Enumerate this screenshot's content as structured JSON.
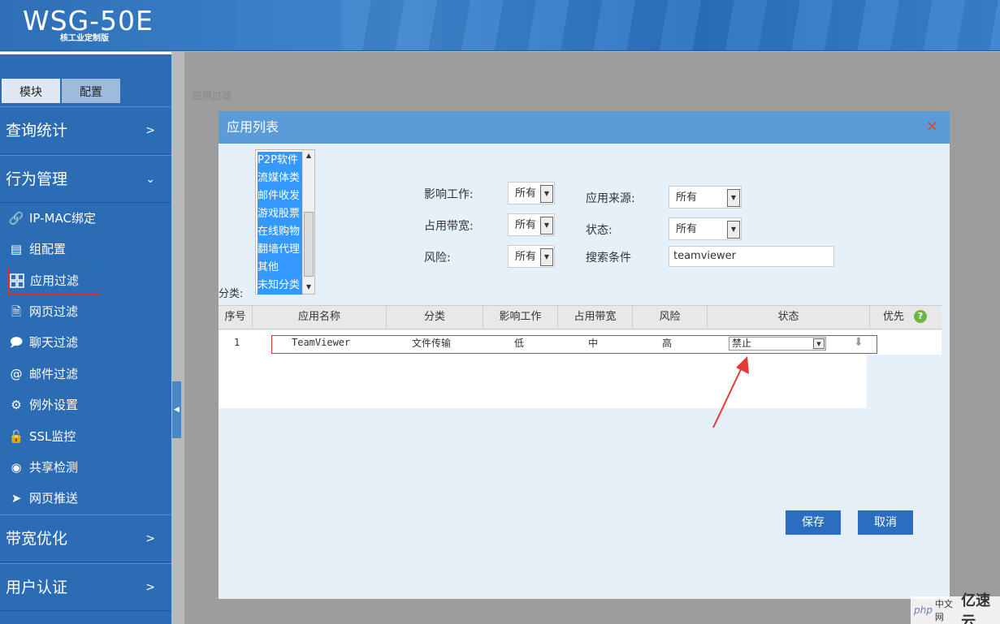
{
  "header": {
    "title": "WSG-50E",
    "subtitle": "核工业定制版"
  },
  "sidebar": {
    "tabs": [
      {
        "label": "模块"
      },
      {
        "label": "配置"
      }
    ],
    "sections": [
      {
        "label": "查询统计",
        "arrow": ">"
      },
      {
        "label": "行为管理",
        "arrow": "v"
      },
      {
        "label": "带宽优化",
        "arrow": ">"
      },
      {
        "label": "用户认证",
        "arrow": ">"
      }
    ],
    "items": [
      {
        "label": "IP-MAC绑定",
        "icon": "link-icon"
      },
      {
        "label": "组配置",
        "icon": "id-card-icon"
      },
      {
        "label": "应用过滤",
        "icon": "grid-icon"
      },
      {
        "label": "网页过滤",
        "icon": "page-icon"
      },
      {
        "label": "聊天过滤",
        "icon": "chat-icon"
      },
      {
        "label": "邮件过滤",
        "icon": "at-icon"
      },
      {
        "label": "例外设置",
        "icon": "gear-icon"
      },
      {
        "label": "SSL监控",
        "icon": "lock-icon"
      },
      {
        "label": "共享检测",
        "icon": "share-icon"
      },
      {
        "label": "网页推送",
        "icon": "send-icon"
      }
    ]
  },
  "modal": {
    "title": "应用列表",
    "category_label": "分类:",
    "categories": [
      "P2P软件",
      "流媒体类",
      "邮件收发",
      "游戏股票",
      "在线购物",
      "翻墙代理",
      "其他",
      "未知分类"
    ],
    "filters": {
      "work_label": "影响工作:",
      "work_value": "所有",
      "bandwidth_label": "占用带宽:",
      "bandwidth_value": "所有",
      "risk_label": "风险:",
      "risk_value": "所有",
      "source_label": "应用来源:",
      "source_value": "所有",
      "status_label": "状态:",
      "status_value": "所有",
      "search_label": "搜索条件",
      "search_value": "teamviewer"
    },
    "table": {
      "headers": [
        "序号",
        "应用名称",
        "分类",
        "影响工作",
        "占用带宽",
        "风险",
        "状态",
        "优先"
      ],
      "rows": [
        {
          "index": "1",
          "name": "TeamViewer",
          "category": "文件传输",
          "work": "低",
          "bandwidth": "中",
          "risk": "高",
          "status": "禁止"
        }
      ]
    },
    "save_label": "保存",
    "cancel_label": "取消"
  },
  "background": {
    "title": "应用过滤"
  },
  "watermark": {
    "php": "php",
    "cn": "中文网",
    "logo": "亿速云"
  },
  "colors": {
    "header": "#3a7fc9",
    "sidebar": "#2b6cb4",
    "modal_head": "#5b9bd8",
    "button": "#2a6fbf",
    "highlight": "#e03030"
  }
}
